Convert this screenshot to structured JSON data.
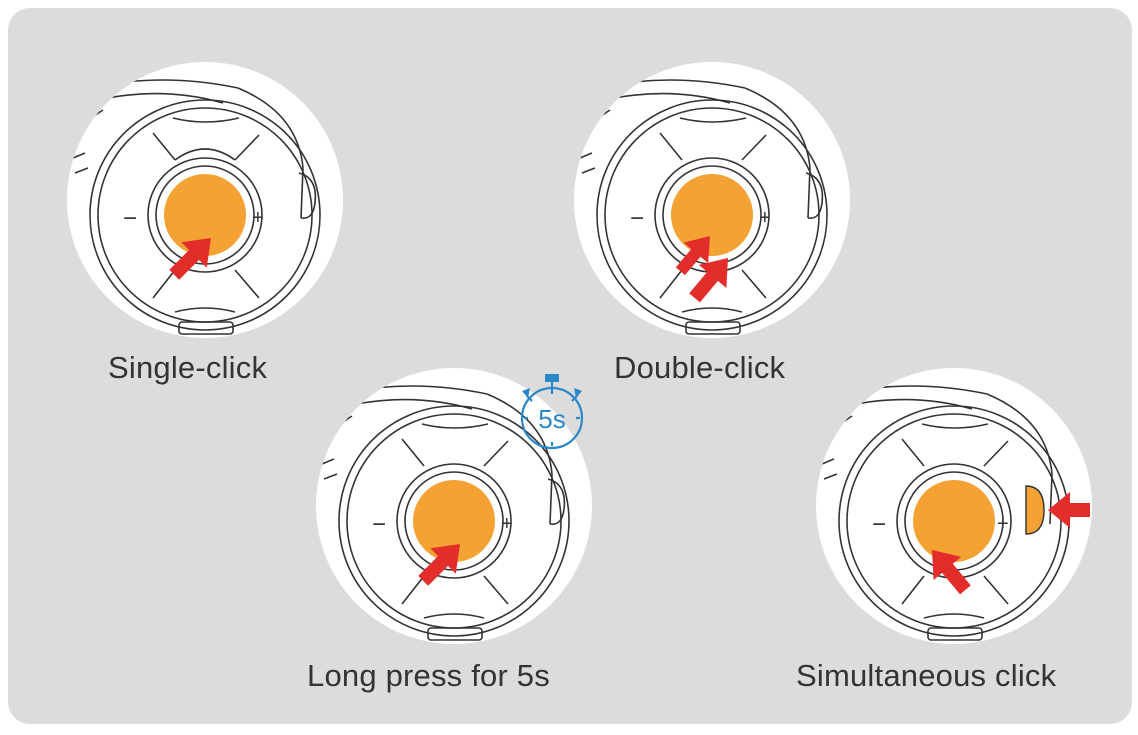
{
  "colors": {
    "background": "#dcdcdc",
    "device_face": "#ffffff",
    "button": "#f4a233",
    "arrow": "#e32d2b",
    "outline": "#333333",
    "timer": "#2a88c8"
  },
  "icons": {
    "arrow": "red-press-arrow-icon",
    "timer": "stopwatch-icon",
    "minus": "minus-icon",
    "plus": "plus-icon"
  },
  "gestures": [
    {
      "caption": "Single-click",
      "arrows": 1
    },
    {
      "caption": "Double-click",
      "arrows": 2
    },
    {
      "caption": "Long press for 5s",
      "arrows": 1,
      "timer_label": "5s"
    },
    {
      "caption": "Simultaneous click",
      "arrows": 2
    }
  ],
  "device_labels": {
    "minus": "−",
    "plus": "+"
  }
}
